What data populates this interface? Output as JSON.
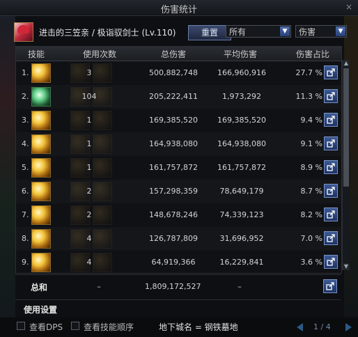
{
  "window": {
    "title": "伤害统计",
    "close_glyph": "×"
  },
  "header": {
    "character": "进击的三笠亲 / 极诣驭剑士 (Lv.110)",
    "reset_label": "重置",
    "filter_select": "所有",
    "type_select": "伤害"
  },
  "columns": [
    "技能",
    "使用次数",
    "总伤害",
    "平均伤害",
    "伤害占比"
  ],
  "rows": [
    {
      "rank": "1.",
      "uses": "3",
      "total": "500,882,748",
      "avg": "166,960,916",
      "share": "27.7 %"
    },
    {
      "rank": "2.",
      "uses": "104",
      "total": "205,222,411",
      "avg": "1,973,292",
      "share": "11.3 %"
    },
    {
      "rank": "3.",
      "uses": "1",
      "total": "169,385,520",
      "avg": "169,385,520",
      "share": "9.4 %"
    },
    {
      "rank": "4.",
      "uses": "1",
      "total": "164,938,080",
      "avg": "164,938,080",
      "share": "9.1 %"
    },
    {
      "rank": "5.",
      "uses": "1",
      "total": "161,757,872",
      "avg": "161,757,872",
      "share": "8.9 %"
    },
    {
      "rank": "6.",
      "uses": "2",
      "total": "157,298,359",
      "avg": "78,649,179",
      "share": "8.7 %"
    },
    {
      "rank": "7.",
      "uses": "2",
      "total": "148,678,246",
      "avg": "74,339,123",
      "share": "8.2 %"
    },
    {
      "rank": "8.",
      "uses": "4",
      "total": "126,787,809",
      "avg": "31,696,952",
      "share": "7.0 %"
    },
    {
      "rank": "9.",
      "uses": "4",
      "total": "64,919,366",
      "avg": "16,229,841",
      "share": "3.6 %"
    }
  ],
  "total": {
    "label": "总和",
    "uses": "–",
    "total": "1,809,172,527",
    "avg": "–"
  },
  "settings": {
    "label": "使用设置"
  },
  "footer": {
    "show_dps": "查看DPS",
    "show_skill_order": "查看技能顺序",
    "dungeon": "地下城名 = 钢铁墓地",
    "page": "1 / 4"
  },
  "icons": {
    "skill_icons": [
      "sword-slash-icon",
      "spirit-swords-icon",
      "sword-rain-icon",
      "sword-pierce-icon",
      "sword-dash-icon",
      "sword-wave-icon",
      "sword-aura-icon",
      "sword-strike-icon",
      "sword-burst-icon"
    ],
    "share": "share-export-icon"
  },
  "colors": {
    "accent": "#3c5a94",
    "skill_gold": "#f2c23a",
    "skill_green": "#64d08a"
  }
}
